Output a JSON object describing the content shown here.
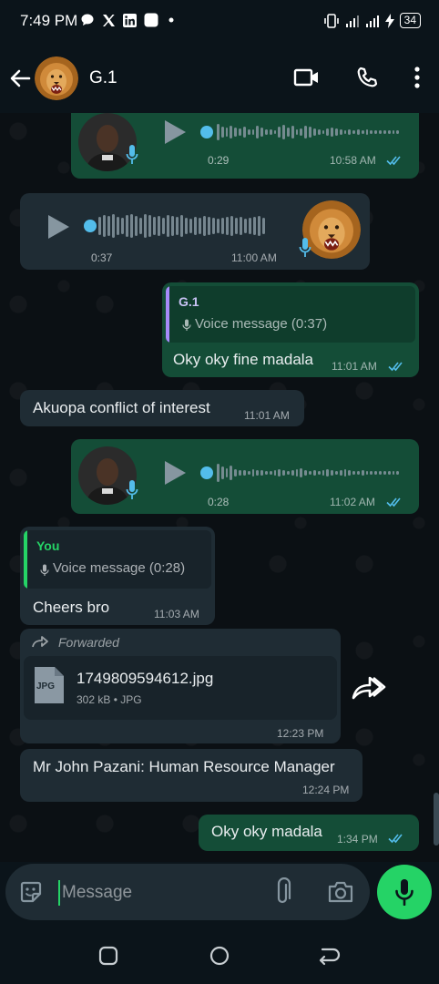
{
  "status_bar": {
    "time": "7:49 PM",
    "battery": "34"
  },
  "header": {
    "contact_name": "G.1"
  },
  "messages": [
    {
      "kind": "voice",
      "direction": "out",
      "duration": "0:29",
      "time": "10:58 AM"
    },
    {
      "kind": "voice",
      "direction": "in",
      "duration": "0:37",
      "time": "11:00 AM"
    },
    {
      "kind": "reply",
      "direction": "out",
      "quote_author": "G.1",
      "quote_text": "Voice message (0:37)",
      "text": "Oky oky fine madala",
      "time": "11:01 AM"
    },
    {
      "kind": "text",
      "direction": "in",
      "text": "Akuopa conflict of interest",
      "time": "11:01 AM"
    },
    {
      "kind": "voice",
      "direction": "out",
      "duration": "0:28",
      "time": "11:02 AM"
    },
    {
      "kind": "reply",
      "direction": "in",
      "quote_author": "You",
      "quote_text": "Voice message (0:28)",
      "text": "Cheers bro",
      "time": "11:03 AM"
    },
    {
      "kind": "file",
      "direction": "in",
      "forwarded_label": "Forwarded",
      "file_type_badge": "JPG",
      "file_name": "1749809594612.jpg",
      "file_meta": "302 kB • JPG",
      "time": "12:23 PM"
    },
    {
      "kind": "text",
      "direction": "in",
      "text": "Mr John Pazani: Human Resource Manager",
      "time": "12:24 PM"
    },
    {
      "kind": "text",
      "direction": "out",
      "text": "Oky oky madala",
      "time": "1:34 PM"
    }
  ],
  "composer": {
    "placeholder": "Message"
  },
  "colors": {
    "outgoing_bubble": "#144d37",
    "incoming_bubble": "#1f2c34",
    "read_ticks": "#53bdeb",
    "accent_green": "#25d366",
    "quote_bar_g1": "#a78bfa",
    "quote_bar_you": "#25d366"
  },
  "icons": {
    "status": [
      "chat-bubble-icon",
      "x-logo-icon",
      "linkedin-icon",
      "app-square-icon",
      "dot-icon",
      "vibrate-icon",
      "signal-icon",
      "signal-icon",
      "charging-icon",
      "battery-icon"
    ],
    "header": [
      "back-arrow-icon",
      "video-call-icon",
      "phone-icon",
      "more-vert-icon"
    ],
    "composer": [
      "sticker-icon",
      "attach-icon",
      "camera-icon",
      "mic-icon"
    ],
    "nav": [
      "recents-icon",
      "home-icon",
      "back-icon"
    ]
  }
}
